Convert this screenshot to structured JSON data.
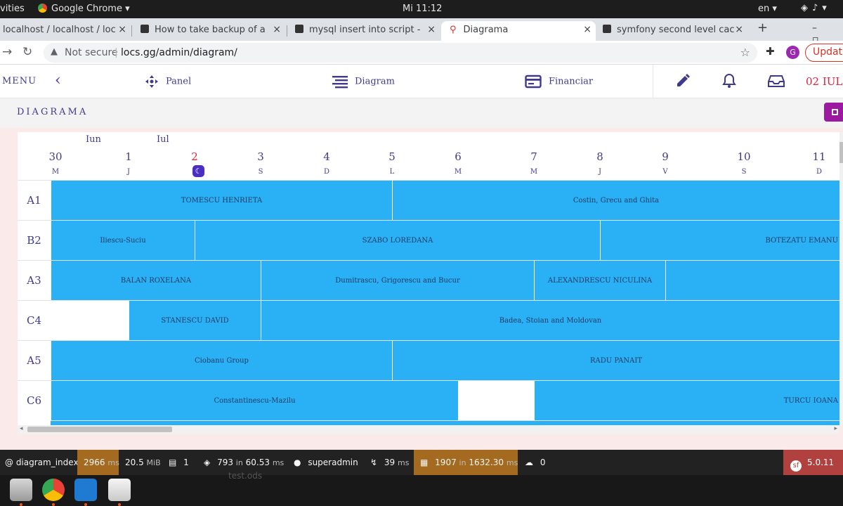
{
  "system": {
    "activities": "vities",
    "app_name": "Google Chrome",
    "clock": "Mi 11:12",
    "lang": "en"
  },
  "tabs": [
    {
      "label": "localhost / localhost / loc",
      "close": "×"
    },
    {
      "label": "How to take backup of a",
      "close": "×"
    },
    {
      "label": "mysql insert into script -",
      "close": "×"
    },
    {
      "label": "Diagrama",
      "close": "×"
    },
    {
      "label": "symfony second level cac",
      "close": "×"
    }
  ],
  "toolbar": {
    "not_secure": "Not secure",
    "url": "locs.gg/admin/diagram/",
    "avatar": "G",
    "update": "Update"
  },
  "appnav": {
    "menu": "MENU",
    "panel": "Panel",
    "diagram": "Diagram",
    "financiar": "Financiar",
    "date": "02 IUL"
  },
  "page": {
    "title": "DIAGRAMA"
  },
  "schedule": {
    "months": [
      "Iun",
      "Iul"
    ],
    "days": [
      {
        "num": "30",
        "dow": "M"
      },
      {
        "num": "1",
        "dow": "J"
      },
      {
        "num": "2",
        "dow": "",
        "today": true
      },
      {
        "num": "3",
        "dow": "S"
      },
      {
        "num": "4",
        "dow": "D"
      },
      {
        "num": "5",
        "dow": "L"
      },
      {
        "num": "6",
        "dow": "M"
      },
      {
        "num": "7",
        "dow": "M"
      },
      {
        "num": "8",
        "dow": "J"
      },
      {
        "num": "9",
        "dow": "V"
      },
      {
        "num": "10",
        "dow": "S"
      },
      {
        "num": "11",
        "dow": "D"
      }
    ],
    "rows": [
      {
        "label": "A1",
        "bookings": [
          {
            "name": "TOMESCU HENRIETA",
            "from": 30,
            "to": 5
          },
          {
            "name": "Costin, Grecu and Ghita",
            "from": 5,
            "to": 11
          }
        ]
      },
      {
        "label": "B2",
        "bookings": [
          {
            "name": "Iliescu-Suciu",
            "from": 30,
            "to": 2
          },
          {
            "name": "SZABO LOREDANA",
            "from": 2,
            "to": 8
          },
          {
            "name": "BOTEZATU EMANU",
            "from": 8,
            "to": 11
          }
        ]
      },
      {
        "label": "A3",
        "bookings": [
          {
            "name": "BALAN ROXELANA",
            "from": 30,
            "to": 3
          },
          {
            "name": "Dumitrascu, Grigorescu and Bucur",
            "from": 3,
            "to": 7
          },
          {
            "name": "ALEXANDRESCU NICULINA",
            "from": 7,
            "to": 9
          },
          {
            "name": "",
            "from": 9,
            "to": 11
          }
        ]
      },
      {
        "label": "C4",
        "bookings": [
          {
            "name": "STANESCU DAVID",
            "from": 1,
            "to": 3
          },
          {
            "name": "Badea, Stoian and Moldovan",
            "from": 3,
            "to": 11
          }
        ]
      },
      {
        "label": "A5",
        "bookings": [
          {
            "name": "Ciobanu Group",
            "from": 30,
            "to": 5
          },
          {
            "name": "RADU PANAIT",
            "from": 5,
            "to": 11
          }
        ]
      },
      {
        "label": "C6",
        "bookings": [
          {
            "name": "Constantinescu-Mazilu",
            "from": 30,
            "to": 6
          },
          {
            "name": "TURCU IOANA",
            "from": 7,
            "to": 11
          }
        ]
      }
    ]
  },
  "profiler": {
    "route": "@ diagram_index",
    "time": "2966",
    "time_unit": "ms",
    "memory": "20.5",
    "memory_unit": "MiB",
    "forms": "1",
    "twig": "793",
    "twig_in": "in",
    "twig_time": "60.53",
    "twig_unit": "ms",
    "user": "superadmin",
    "events": "39",
    "events_unit": "ms",
    "db": "1907",
    "db_in": "in",
    "db_time": "1632.30",
    "db_unit": "ms",
    "cache": "0",
    "version": "5.0.11"
  },
  "colors": {
    "booking": "#2ab0f4",
    "accent": "#3f3a8c",
    "today": "#e0213b",
    "profiler_highlight": "#a46a1f"
  },
  "dock": {
    "ghost_text": "test.ods"
  }
}
